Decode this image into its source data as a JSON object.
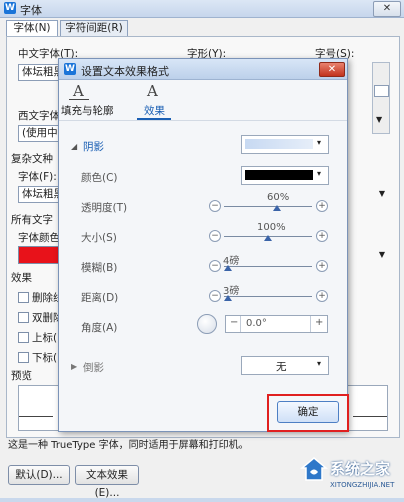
{
  "outer_dialog": {
    "title": "字体",
    "tabs": [
      "字体(N)",
      "字符间距(R)"
    ],
    "chinese_font_label": "中文字体(T):",
    "chinese_font_value": "体坛粗黑",
    "font_style_label": "字形(Y):",
    "font_size_label": "字号(S):",
    "western_font_label": "西文字体(",
    "western_font_value": "(使用中文",
    "complex_script_label": "复杂文种",
    "complex_font_label": "字体(F):",
    "complex_font_value": "体坛粗黑",
    "all_text_label": "所有文字",
    "font_color_label": "字体颜色(",
    "font_color_value": "#e8121a",
    "effects_label": "效果",
    "effect_items": [
      "删除线",
      "双删除",
      "上标(",
      "下标("
    ],
    "preview_label": "预览",
    "info_text": "这是一种 TrueType 字体，同时适用于屏幕和打印机。",
    "default_button": "默认(D)...",
    "text_effect_button": "文本效果(E)..."
  },
  "inner_dialog": {
    "title": "设置文本效果格式",
    "tabs": [
      "填充与轮廓",
      "效果"
    ],
    "shadow_section": "阴影",
    "color_label": "颜色(C)",
    "color_value": "#000000",
    "transparency_label": "透明度(T)",
    "transparency_value": "60%",
    "transparency_level": 0.6,
    "size_label": "大小(S)",
    "size_value": "100%",
    "size_level": 0.5,
    "blur_label": "模糊(B)",
    "blur_value": "4磅",
    "blur_level": 0.05,
    "distance_label": "距离(D)",
    "distance_value": "3磅",
    "distance_level": 0.04,
    "angle_label": "角度(A)",
    "angle_value": "0.0°",
    "reflection_section": "倒影",
    "reflection_value": "无",
    "confirm_button": "确定"
  },
  "watermark": {
    "text": "系统之家",
    "url": "XITONGZHIJIA.NET"
  },
  "colors": {
    "accent": "#1a74d8",
    "highlight_red": "#e02020"
  }
}
